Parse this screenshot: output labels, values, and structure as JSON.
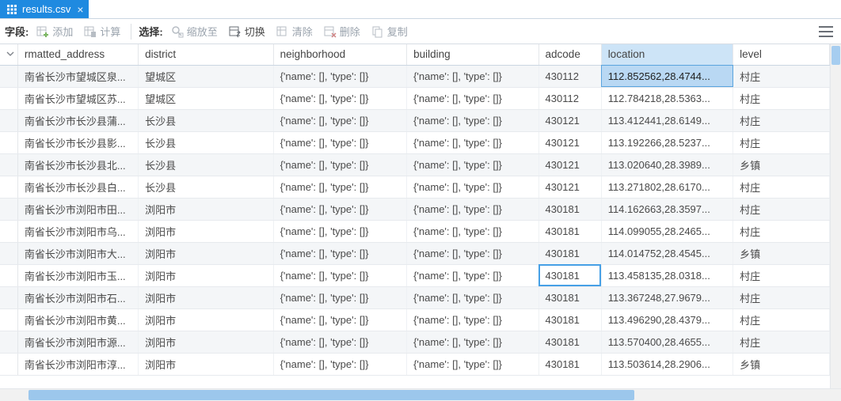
{
  "tab": {
    "title": "results.csv"
  },
  "toolbar": {
    "fields_label": "字段:",
    "add_label": "添加",
    "calc_label": "计算",
    "select_label": "选择:",
    "zoom_label": "缩放至",
    "switch_label": "切换",
    "clear_label": "清除",
    "delete_label": "删除",
    "copy_label": "复制"
  },
  "columns": {
    "rmatted_address": "rmatted_address",
    "district": "district",
    "neighborhood": "neighborhood",
    "building": "building",
    "adcode": "adcode",
    "location": "location",
    "level": "level"
  },
  "selected_column": "location",
  "active_cell": {
    "row": 0,
    "col": "location"
  },
  "highlight_cell": {
    "row": 9,
    "col": "adcode"
  },
  "rows": [
    {
      "rmatted_address": "南省长沙市望城区泉...",
      "district": "望城区",
      "neighborhood": "{'name': [], 'type': []}",
      "building": "{'name': [], 'type': []}",
      "adcode": "430112",
      "location": "112.852562,28.4744...",
      "level": "村庄"
    },
    {
      "rmatted_address": "南省长沙市望城区苏...",
      "district": "望城区",
      "neighborhood": "{'name': [], 'type': []}",
      "building": "{'name': [], 'type': []}",
      "adcode": "430112",
      "location": "112.784218,28.5363...",
      "level": "村庄"
    },
    {
      "rmatted_address": "南省长沙市长沙县蒲...",
      "district": "长沙县",
      "neighborhood": "{'name': [], 'type': []}",
      "building": "{'name': [], 'type': []}",
      "adcode": "430121",
      "location": "113.412441,28.6149...",
      "level": "村庄"
    },
    {
      "rmatted_address": "南省长沙市长沙县影...",
      "district": "长沙县",
      "neighborhood": "{'name': [], 'type': []}",
      "building": "{'name': [], 'type': []}",
      "adcode": "430121",
      "location": "113.192266,28.5237...",
      "level": "村庄"
    },
    {
      "rmatted_address": "南省长沙市长沙县北...",
      "district": "长沙县",
      "neighborhood": "{'name': [], 'type': []}",
      "building": "{'name': [], 'type': []}",
      "adcode": "430121",
      "location": "113.020640,28.3989...",
      "level": "乡镇"
    },
    {
      "rmatted_address": "南省长沙市长沙县白...",
      "district": "长沙县",
      "neighborhood": "{'name': [], 'type': []}",
      "building": "{'name': [], 'type': []}",
      "adcode": "430121",
      "location": "113.271802,28.6170...",
      "level": "村庄"
    },
    {
      "rmatted_address": "南省长沙市浏阳市田...",
      "district": "浏阳市",
      "neighborhood": "{'name': [], 'type': []}",
      "building": "{'name': [], 'type': []}",
      "adcode": "430181",
      "location": "114.162663,28.3597...",
      "level": "村庄"
    },
    {
      "rmatted_address": "南省长沙市浏阳市乌...",
      "district": "浏阳市",
      "neighborhood": "{'name': [], 'type': []}",
      "building": "{'name': [], 'type': []}",
      "adcode": "430181",
      "location": "114.099055,28.2465...",
      "level": "村庄"
    },
    {
      "rmatted_address": "南省长沙市浏阳市大...",
      "district": "浏阳市",
      "neighborhood": "{'name': [], 'type': []}",
      "building": "{'name': [], 'type': []}",
      "adcode": "430181",
      "location": "114.014752,28.4545...",
      "level": "乡镇"
    },
    {
      "rmatted_address": "南省长沙市浏阳市玉...",
      "district": "浏阳市",
      "neighborhood": "{'name': [], 'type': []}",
      "building": "{'name': [], 'type': []}",
      "adcode": "430181",
      "location": "113.458135,28.0318...",
      "level": "村庄"
    },
    {
      "rmatted_address": "南省长沙市浏阳市石...",
      "district": "浏阳市",
      "neighborhood": "{'name': [], 'type': []}",
      "building": "{'name': [], 'type': []}",
      "adcode": "430181",
      "location": "113.367248,27.9679...",
      "level": "村庄"
    },
    {
      "rmatted_address": "南省长沙市浏阳市黄...",
      "district": "浏阳市",
      "neighborhood": "{'name': [], 'type': []}",
      "building": "{'name': [], 'type': []}",
      "adcode": "430181",
      "location": "113.496290,28.4379...",
      "level": "村庄"
    },
    {
      "rmatted_address": "南省长沙市浏阳市源...",
      "district": "浏阳市",
      "neighborhood": "{'name': [], 'type': []}",
      "building": "{'name': [], 'type': []}",
      "adcode": "430181",
      "location": "113.570400,28.4655...",
      "level": "村庄"
    },
    {
      "rmatted_address": "南省长沙市浏阳市淳...",
      "district": "浏阳市",
      "neighborhood": "{'name': [], 'type': []}",
      "building": "{'name': [], 'type': []}",
      "adcode": "430181",
      "location": "113.503614,28.2906...",
      "level": "乡镇"
    }
  ]
}
